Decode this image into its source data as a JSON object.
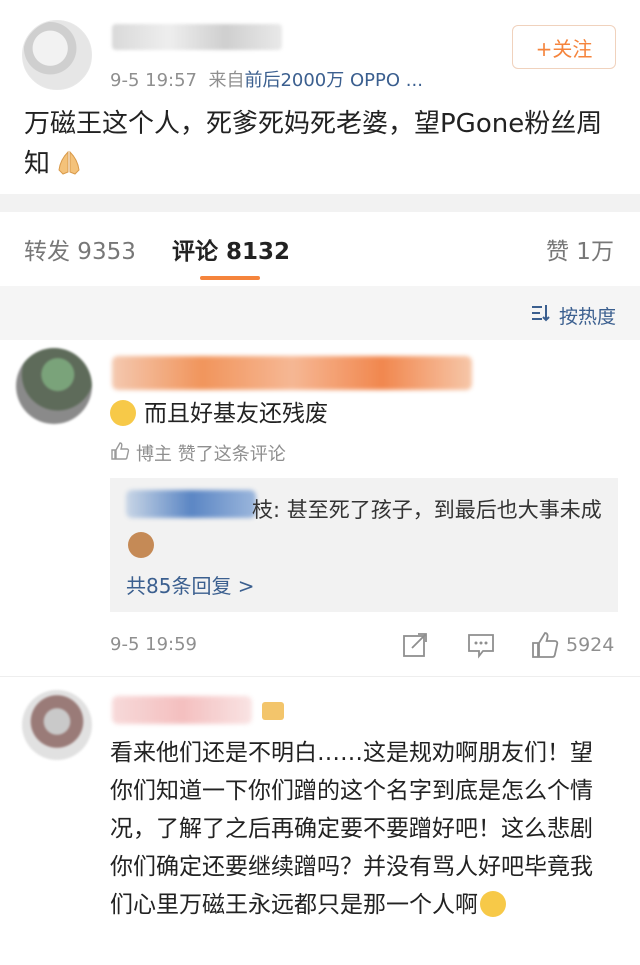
{
  "post": {
    "time": "9-5 19:57",
    "source_prefix": "来自",
    "source": "前后2000万 OPPO ...",
    "follow_label": "+关注",
    "text": "万磁王这个人，死爹死妈死老婆，望PGone粉丝周知"
  },
  "tabs": {
    "repost": "转发 9353",
    "comment": "评论 8132",
    "like": "赞 1万"
  },
  "sort": {
    "label": "按热度"
  },
  "comments": [
    {
      "text": "而且好基友还残废",
      "liked_by": "博主 赞了这条评论",
      "reply_suffix": "枝: 甚至死了孩子，到最后也大事未成",
      "replies_more": "共85条回复 >",
      "time": "9-5 19:59",
      "likes": "5924"
    },
    {
      "text": "看来他们还是不明白……这是规劝啊朋友们！望你们知道一下你们蹭的这个名字到底是怎么个情况，了解了之后再确定要不要蹭好吧！这么悲剧你们确定还要继续蹭吗？并没有骂人好吧毕竟我们心里万磁王永远都只是那一个人啊"
    }
  ],
  "colors": {
    "accent": "#f5843c",
    "link": "#3b5f8f",
    "muted": "#8f8f8f"
  }
}
